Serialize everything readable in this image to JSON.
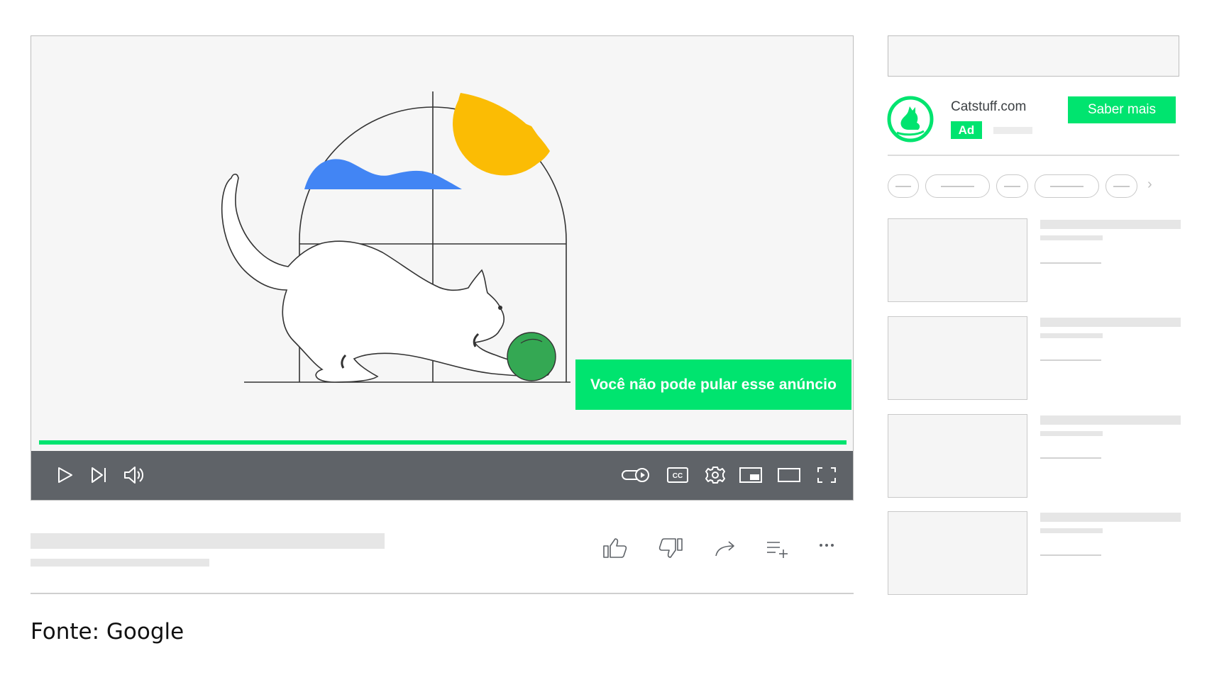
{
  "player": {
    "skip_notice": "Você não pode pular esse anúncio",
    "ad_progress": 1.0,
    "controls_left": [
      "play-icon",
      "next-icon",
      "volume-icon"
    ],
    "controls_right": [
      "autoplay-toggle-icon",
      "captions-icon",
      "settings-icon",
      "miniplayer-icon",
      "theater-mode-icon",
      "fullscreen-icon"
    ],
    "captions_label": "CC"
  },
  "actions": [
    "like-icon",
    "dislike-icon",
    "share-icon",
    "save-to-playlist-icon",
    "more-icon"
  ],
  "ad": {
    "domain": "Catstuff.com",
    "badge": "Ad",
    "cta": "Saber mais"
  },
  "source_caption": "Fonte: Google",
  "colors": {
    "accent_green": "#00e46f",
    "controls_bar": "#5f6368",
    "sun_yellow": "#fbbc04",
    "cloud_blue": "#4285f4",
    "ball_green": "#34a853"
  }
}
